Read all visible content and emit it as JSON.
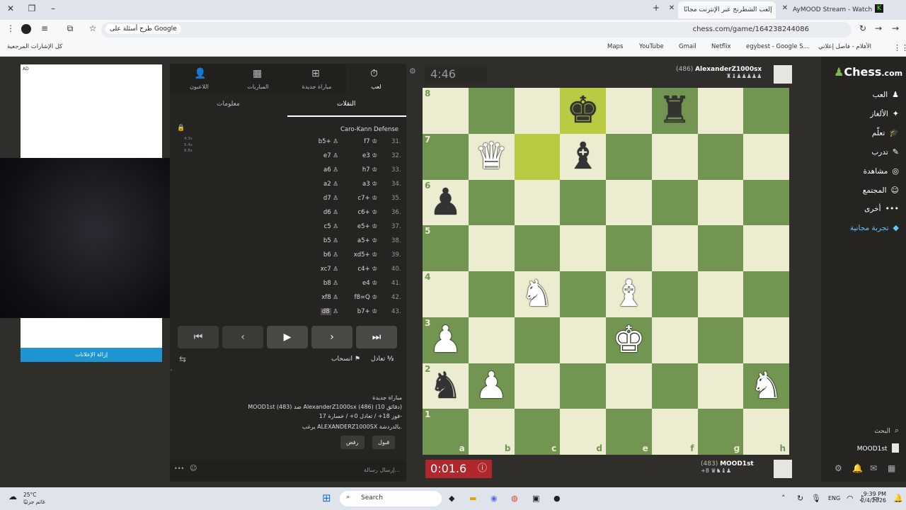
{
  "browser": {
    "tabs": [
      {
        "label": "AyMOOD Stream - Watch Live"
      },
      {
        "label": "إلعب الشطرنج عبر الإنترنت مجانًا"
      }
    ],
    "url": "chess.com/game/164238244086",
    "search_chip": "طرح أسئلة على Google",
    "bookmarks": [
      "Maps",
      "YouTube",
      "Gmail",
      "Netflix",
      "egybest - Google S...",
      "الأفلام - فاصل إعلاني",
      "كل الإشارات المرجعية"
    ]
  },
  "ad": {
    "label": "AD",
    "remove_label": "إزالة الإعلانات"
  },
  "panel": {
    "tabs": [
      {
        "label": "اللاعبون",
        "icon": "people-icon"
      },
      {
        "label": "المباريات",
        "icon": "board-icon"
      },
      {
        "label": "مباراة جديدة",
        "icon": "plus-icon"
      },
      {
        "label": "لعب",
        "icon": "clock-icon"
      }
    ],
    "subtabs": {
      "moves": "النقلات",
      "info": "معلومات"
    },
    "opening": "Caro-Kann Defense",
    "moves": [
      {
        "n": "31.",
        "w": "f7",
        "b": "b5+"
      },
      {
        "n": "32.",
        "w": "e3",
        "b": "e7"
      },
      {
        "n": "33.",
        "w": "h7",
        "b": "a6"
      },
      {
        "n": "34.",
        "w": "a3",
        "b": "a2"
      },
      {
        "n": "35.",
        "w": "c7+",
        "b": "d7"
      },
      {
        "n": "36.",
        "w": "c6+",
        "b": "d6"
      },
      {
        "n": "37.",
        "w": "e5+",
        "b": "c5"
      },
      {
        "n": "38.",
        "w": "a5+",
        "b": "b5"
      },
      {
        "n": "39.",
        "w": "xd5+",
        "b": "b6"
      },
      {
        "n": "40.",
        "w": "c4+",
        "b": "xc7"
      },
      {
        "n": "41.",
        "w": "e4",
        "b": "b8"
      },
      {
        "n": "42.",
        "w": "f8=Q",
        "b": "xf8"
      },
      {
        "n": "43.",
        "w": "b7+",
        "b": "d8"
      }
    ],
    "move_times": [
      "4.3s",
      "5.4s",
      "8.8s"
    ],
    "actions": {
      "draw": "تعادل",
      "draw_sym": "½",
      "resign": "انسحاب"
    },
    "chat": {
      "title": "مباراة جديدة",
      "line1": "MOOD1st (483) ضد AlexanderZ1000sx (486) (10 دقائق)",
      "line2": "فوز 18+ / تعادل 0+ / خسارة 17-",
      "line3": "يرغب ALEXANDERZ1000SX بالدردشة.",
      "accept": "قبول",
      "decline": "رفض"
    },
    "message_placeholder": "إرسال رسالة..."
  },
  "game": {
    "top_player": {
      "name": "AlexanderZ1000sx",
      "rating": "(486)",
      "timer": "4:46"
    },
    "bottom_player": {
      "name": "MOOD1st",
      "rating": "(483)",
      "timer": "0:01.6",
      "material": "+8"
    },
    "board": [
      [
        "",
        "",
        "",
        "bK",
        "",
        "bR",
        "",
        ""
      ],
      [
        "",
        "wQ",
        "",
        "bB",
        "",
        "",
        "",
        ""
      ],
      [
        "bP",
        "",
        "",
        "",
        "",
        "",
        "",
        ""
      ],
      [
        "",
        "",
        "",
        "",
        "",
        "",
        "",
        ""
      ],
      [
        "",
        "",
        "wN",
        "",
        "wB",
        "",
        "",
        ""
      ],
      [
        "wP",
        "",
        "",
        "",
        "wK",
        "",
        "",
        ""
      ],
      [
        "bN",
        "wP",
        "",
        "",
        "",
        "",
        "",
        "wN"
      ],
      [
        "",
        "",
        "",
        "",
        "",
        "",
        "",
        ""
      ]
    ],
    "highlight": [
      [
        0,
        3
      ],
      [
        1,
        2
      ]
    ],
    "files": [
      "a",
      "b",
      "c",
      "d",
      "e",
      "f",
      "g",
      "h"
    ],
    "ranks": [
      "8",
      "7",
      "6",
      "5",
      "4",
      "3",
      "2",
      "1"
    ]
  },
  "nav": {
    "logo_text": "Chess",
    "logo_suffix": ".com",
    "items": [
      "العب",
      "الألغاز",
      "تعلّم",
      "تدرب",
      "مشاهدة",
      "المجتمع",
      "أخرى",
      "تجربة مجانية"
    ],
    "search": "البحث",
    "user": "MOOD1st"
  },
  "taskbar": {
    "weather_temp": "25°C",
    "weather_text": "غائم جزئيًا",
    "search": "Search",
    "lang": "ENG",
    "time": "9:39 PM",
    "date": "2/4/2026"
  }
}
